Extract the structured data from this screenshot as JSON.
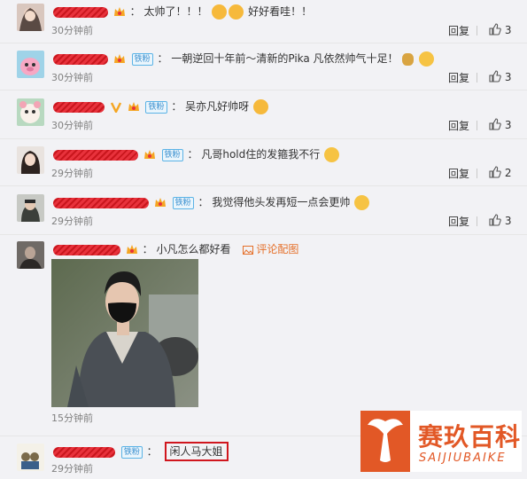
{
  "reply_label": "回复",
  "comments": [
    {
      "text": "太帅了！！！",
      "text2": "好好看哇！！",
      "time": "30分钟前",
      "likes": "3"
    },
    {
      "fan_badge": "铁粉",
      "text": "一朝逆回十年前～清新的Pika 凡依然帅气十足！",
      "time": "30分钟前",
      "likes": "3"
    },
    {
      "fan_badge": "铁粉",
      "text": "吴亦凡好帅呀",
      "time": "30分钟前",
      "likes": "3"
    },
    {
      "fan_badge": "铁粉",
      "text": "凡哥hold住的发箍我不行",
      "time": "29分钟前",
      "likes": "2"
    },
    {
      "fan_badge": "铁粉",
      "text": "我觉得他头发再短一点会更帅",
      "time": "29分钟前",
      "likes": "3"
    },
    {
      "text": "小凡怎么都好看",
      "pic_link": "评论配图",
      "time": "15分钟前"
    },
    {
      "fan_badge": "铁粉",
      "text": "闲人马大姐",
      "time": "29分钟前"
    }
  ],
  "watermark": {
    "title": "赛玖百科",
    "subtitle": "SAIJIUBAIKE"
  },
  "colors": {
    "accent_red": "#d0161e",
    "fan_blue": "#3a8fcf",
    "link_orange": "#e5702a",
    "logo_orange": "#e25826"
  }
}
